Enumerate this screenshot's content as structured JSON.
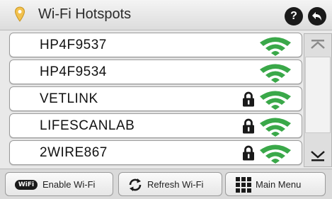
{
  "header": {
    "title": "Wi-Fi Hotspots",
    "help_label": "?",
    "pin_icon": "location-pin-icon",
    "back_icon": "back-arrow-icon"
  },
  "networks": [
    {
      "ssid": "HP4F9537",
      "locked": false
    },
    {
      "ssid": "HP4F9534",
      "locked": false
    },
    {
      "ssid": "VETLINK",
      "locked": true
    },
    {
      "ssid": "LIFESCANLAB",
      "locked": true
    },
    {
      "ssid": "2WIRE867",
      "locked": true
    }
  ],
  "toolbar": {
    "enable_badge": "WiFi",
    "enable_label": "Enable Wi-Fi",
    "refresh_label": "Refresh Wi-Fi",
    "menu_label": "Main Menu"
  },
  "colors": {
    "signal": "#3aa849",
    "pin": "#f2c14e",
    "text": "#111111"
  }
}
